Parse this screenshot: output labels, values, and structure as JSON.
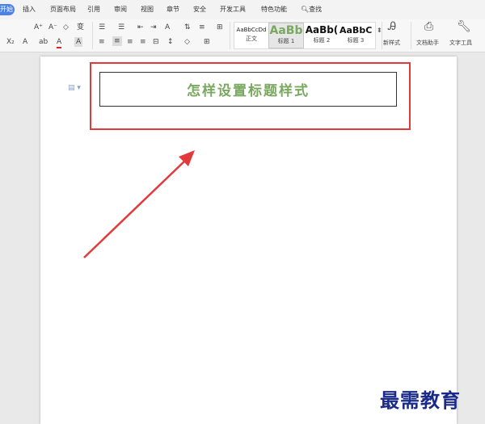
{
  "tabs": [
    "开始",
    "插入",
    "页面布局",
    "引用",
    "审阅",
    "视图",
    "章节",
    "安全",
    "开发工具",
    "特色功能",
    "查找"
  ],
  "ribbon": {
    "font_row1": [
      "A⁺",
      "A⁻",
      "◇",
      "变"
    ],
    "font_row2": [
      "X₂",
      "A",
      "ab",
      "A",
      "A"
    ],
    "para_row1": [
      "☰",
      "☰",
      "⇤",
      "⇥",
      "A",
      "⇅",
      "≡",
      "⊞"
    ],
    "para_row2": [
      "≡",
      "≡",
      "≡",
      "≡",
      "⊟",
      "↕",
      "◇",
      "⊞"
    ],
    "styles": [
      {
        "preview": "AaBbCcDd",
        "name": "正文"
      },
      {
        "preview": "AaBb",
        "name": "标题 1"
      },
      {
        "preview": "AaBb(",
        "name": "标题 2"
      },
      {
        "preview": "AaBbC",
        "name": "标题 3"
      }
    ],
    "new_style": "新样式",
    "doc_assistant": "文档助手",
    "text_tools": "文字工具"
  },
  "document": {
    "title": "怎样设置标题样式"
  },
  "watermark": "最需教育",
  "colors": {
    "accent_tab": "#4a82e8",
    "title_green": "#7aa860",
    "highlight_red": "#e23a3a"
  }
}
